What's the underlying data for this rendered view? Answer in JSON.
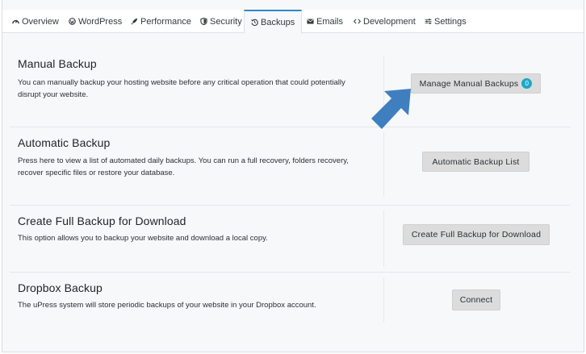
{
  "tabs": [
    {
      "label": "Overview",
      "icon": "dashboard-icon"
    },
    {
      "label": "WordPress",
      "icon": "wordpress-icon"
    },
    {
      "label": "Performance",
      "icon": "rocket-icon"
    },
    {
      "label": "Security",
      "icon": "shield-icon"
    },
    {
      "label": "Backups",
      "icon": "history-icon",
      "active": true
    },
    {
      "label": "Emails",
      "icon": "envelope-icon"
    },
    {
      "label": "Development",
      "icon": "code-icon"
    },
    {
      "label": "Settings",
      "icon": "sliders-icon"
    }
  ],
  "sections": {
    "manual": {
      "title": "Manual Backup",
      "desc_line1": "You can manually backup your hosting website before any critical operation that could potentially",
      "desc_line2": "disrupt your website.",
      "button_label": "Manage Manual Backups",
      "badge_count": "0"
    },
    "automatic": {
      "title": "Automatic Backup",
      "desc_line1": "Press here to view a list of automated daily backups. You can run a full recovery, folders recovery,",
      "desc_line2": "recover specific files or restore your database.",
      "button_label": "Automatic Backup List"
    },
    "download": {
      "title": "Create Full Backup for Download",
      "desc_line1": "This option allows you to backup your website and download a local copy.",
      "button_label": "Create Full Backup for Download"
    },
    "dropbox": {
      "title": "Dropbox Backup",
      "desc_line1": "The uPress system will store periodic backups of your website in your Dropbox account.",
      "button_label": "Connect"
    }
  },
  "colors": {
    "accent": "#2f88c8",
    "badge": "#1ea7c9",
    "arrow": "#3f7fc0"
  }
}
